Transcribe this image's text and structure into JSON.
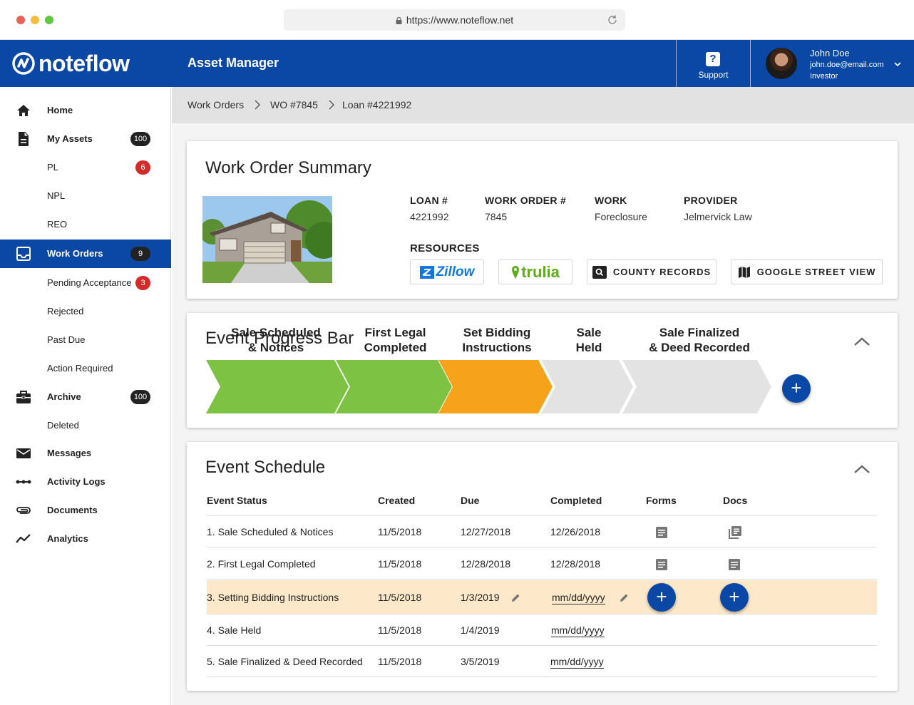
{
  "browser": {
    "url": "https://www.noteflow.net"
  },
  "header": {
    "logo_text": "noteflow",
    "app_title": "Asset Manager",
    "support_label": "Support",
    "user": {
      "name": "John Doe",
      "email": "john.doe@email.com",
      "role": "Investor"
    },
    "brand_color": "#0b47a5"
  },
  "sidebar": {
    "items": [
      {
        "label": "Home",
        "icon": "home-icon",
        "bold": true
      },
      {
        "label": "My Assets",
        "icon": "document-icon",
        "bold": true,
        "badge": "100"
      },
      {
        "label": "PL",
        "badge": "6"
      },
      {
        "label": "NPL"
      },
      {
        "label": "REO"
      },
      {
        "label": "Work Orders",
        "icon": "inbox-icon",
        "bold": true,
        "badge": "9",
        "active": true
      },
      {
        "label": "Pending Acceptance",
        "badge": "3"
      },
      {
        "label": "Rejected"
      },
      {
        "label": "Past Due"
      },
      {
        "label": "Action Required"
      },
      {
        "label": "Archive",
        "icon": "briefcase-icon",
        "bold": true,
        "badge": "100"
      },
      {
        "label": "Deleted"
      },
      {
        "label": "Messages",
        "icon": "mail-icon",
        "bold": true
      },
      {
        "label": "Activity Logs",
        "icon": "timeline-icon",
        "bold": true
      },
      {
        "label": "Documents",
        "icon": "paperclip-icon",
        "bold": true
      },
      {
        "label": "Analytics",
        "icon": "analytics-icon",
        "bold": true
      }
    ]
  },
  "breadcrumb": [
    "Work Orders",
    "WO #7845",
    "Loan #4221992"
  ],
  "summary": {
    "title": "Work Order Summary",
    "fields": [
      {
        "label": "LOAN #",
        "value": "4221992"
      },
      {
        "label": "WORK ORDER #",
        "value": "7845"
      },
      {
        "label": "WORK",
        "value": "Foreclosure"
      },
      {
        "label": "PROVIDER",
        "value": "Jelmervick Law"
      }
    ],
    "resources_label": "RESOURCES",
    "resources": {
      "zillow": "Zillow",
      "trulia": "trulia",
      "county": "COUNTY RECORDS",
      "street": "GOOGLE STREET VIEW"
    }
  },
  "progress": {
    "title": "Event Progress Bar",
    "steps": [
      {
        "line1": "Sale Scheduled",
        "line2": "& Notices",
        "status": "complete",
        "color": "#7dc242"
      },
      {
        "line1": "First Legal",
        "line2": "Completed",
        "status": "complete",
        "color": "#7dc242"
      },
      {
        "line1": "Set Bidding",
        "line2": "Instructions",
        "status": "current",
        "color": "#f7a21b"
      },
      {
        "line1": "Sale",
        "line2": "Held",
        "status": "pending",
        "color": "#e3e3e3"
      },
      {
        "line1": "Sale Finalized",
        "line2": "& Deed Recorded",
        "status": "pending",
        "color": "#e3e3e3"
      }
    ],
    "add_label": "+"
  },
  "schedule": {
    "title": "Event Schedule",
    "columns": [
      "Event Status",
      "Created",
      "Due",
      "Completed",
      "Forms",
      "Docs"
    ],
    "rows": [
      {
        "status": "1. Sale Scheduled & Notices",
        "created": "11/5/2018",
        "due": "12/27/2018",
        "completed": "12/26/2018"
      },
      {
        "status": "2. First Legal Completed",
        "created": "11/5/2018",
        "due": "12/28/2018",
        "completed": "12/28/2018"
      },
      {
        "status": "3. Setting Bidding Instructions",
        "created": "11/5/2018",
        "due": "1/3/2019",
        "completed": "mm/dd/yyyy"
      },
      {
        "status": "4. Sale Held",
        "created": "11/5/2018",
        "due": "1/4/2019",
        "completed": "mm/dd/yyyy"
      },
      {
        "status": "5. Sale Finalized & Deed Recorded",
        "created": "11/5/2018",
        "due": "3/5/2019",
        "completed": "mm/dd/yyyy"
      }
    ],
    "add_label": "+"
  }
}
